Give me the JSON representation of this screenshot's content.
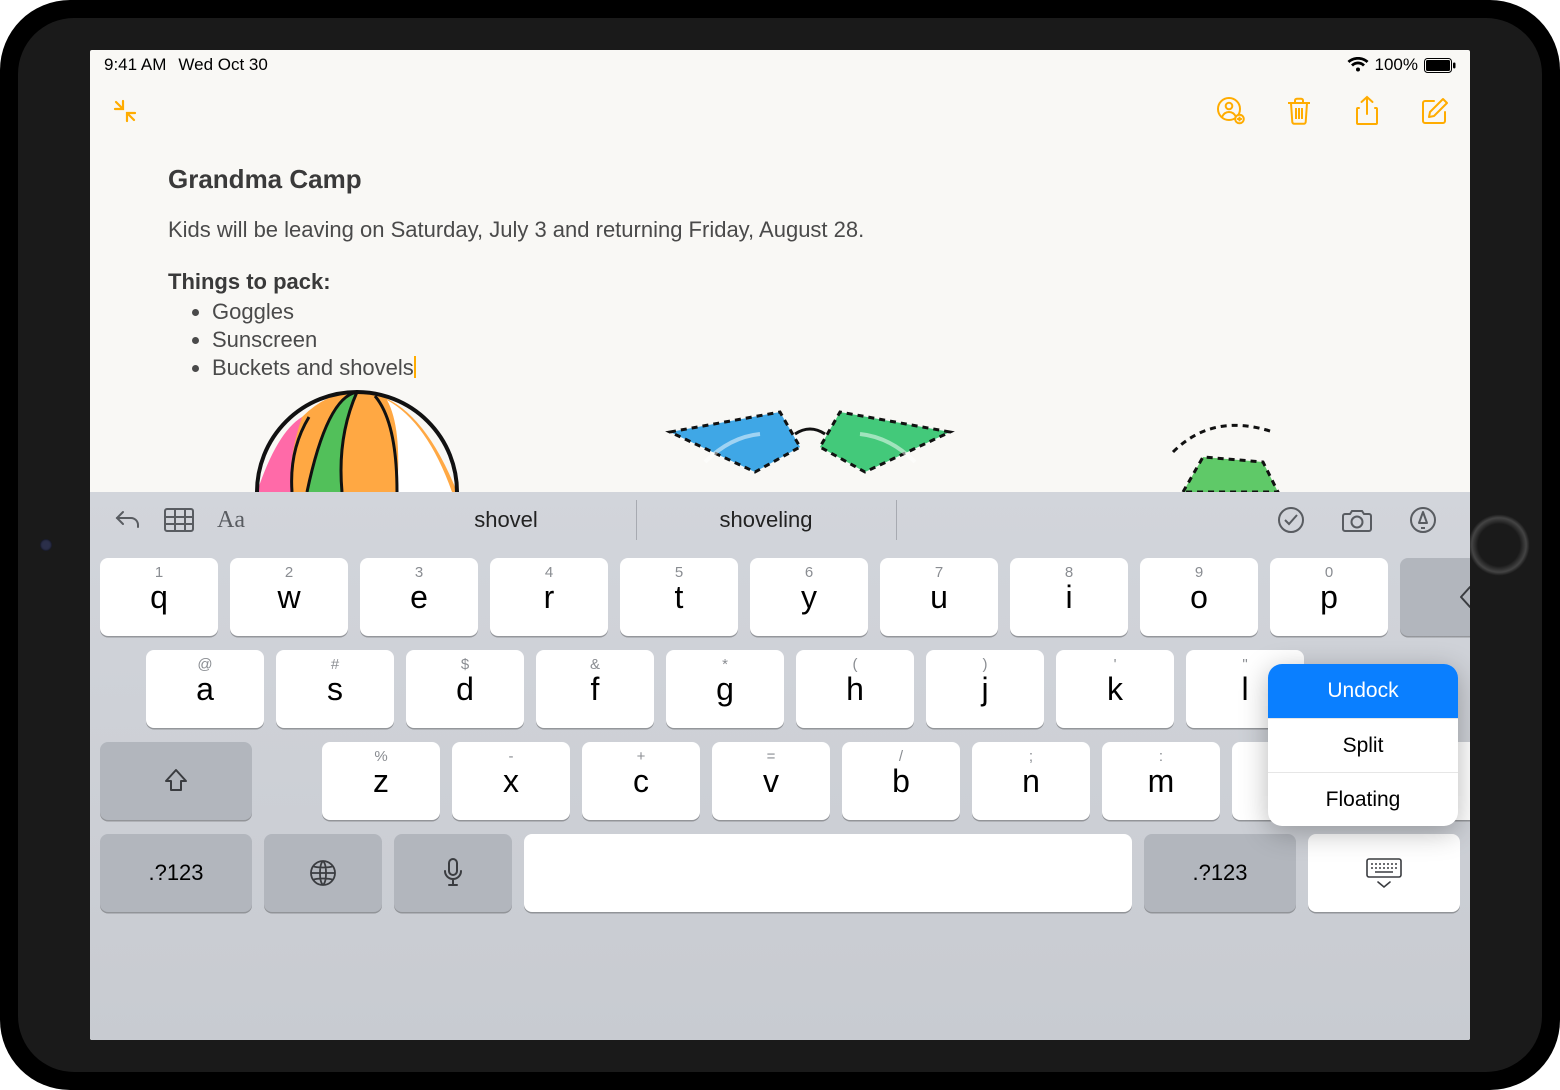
{
  "status": {
    "time": "9:41 AM",
    "date": "Wed Oct 30",
    "battery_pct": "100%"
  },
  "note": {
    "title": "Grandma Camp",
    "body": "Kids will be leaving on Saturday, July 3 and returning Friday, August 28.",
    "subhead": "Things to pack:",
    "items": [
      "Goggles",
      "Sunscreen",
      "Buckets and shovels"
    ]
  },
  "keyboard": {
    "suggestion_1": "shovel",
    "suggestion_2": "shoveling",
    "row1": [
      {
        "sup": "1",
        "main": "q"
      },
      {
        "sup": "2",
        "main": "w"
      },
      {
        "sup": "3",
        "main": "e"
      },
      {
        "sup": "4",
        "main": "r"
      },
      {
        "sup": "5",
        "main": "t"
      },
      {
        "sup": "6",
        "main": "y"
      },
      {
        "sup": "7",
        "main": "u"
      },
      {
        "sup": "8",
        "main": "i"
      },
      {
        "sup": "9",
        "main": "o"
      },
      {
        "sup": "0",
        "main": "p"
      }
    ],
    "row2": [
      {
        "sup": "@",
        "main": "a"
      },
      {
        "sup": "#",
        "main": "s"
      },
      {
        "sup": "$",
        "main": "d"
      },
      {
        "sup": "&",
        "main": "f"
      },
      {
        "sup": "*",
        "main": "g"
      },
      {
        "sup": "(",
        "main": "h"
      },
      {
        "sup": ")",
        "main": "j"
      },
      {
        "sup": "'",
        "main": "k"
      },
      {
        "sup": "\"",
        "main": "l"
      }
    ],
    "row3": [
      {
        "sup": "%",
        "main": "z"
      },
      {
        "sup": "-",
        "main": "x"
      },
      {
        "sup": "+",
        "main": "c"
      },
      {
        "sup": "=",
        "main": "v"
      },
      {
        "sup": "/",
        "main": "b"
      },
      {
        "sup": ";",
        "main": "n"
      },
      {
        "sup": ":",
        "main": "m"
      },
      {
        "sup": "!",
        "main": ","
      },
      {
        "sup": "?",
        "main": "."
      }
    ],
    "mode_label": ".?123",
    "popover": {
      "undock": "Undock",
      "split": "Split",
      "floating": "Floating"
    }
  }
}
